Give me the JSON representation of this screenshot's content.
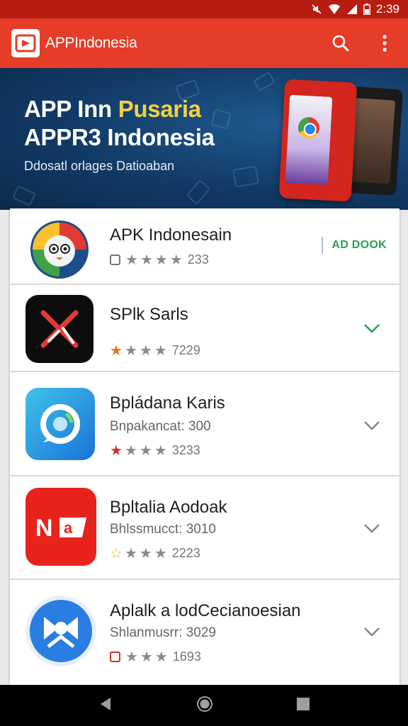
{
  "status_bar": {
    "time": "2:39"
  },
  "app_bar": {
    "title": "APPIndonesia"
  },
  "hero": {
    "title_line1_white": "APP Inn ",
    "title_line1_accent": "Pusaria",
    "title_line2": "APPR3 Indonesia",
    "subtitle": "Ddosatl orlages Datioaban"
  },
  "apps": [
    {
      "name": "APK Indonesain",
      "sub": "",
      "rating": "233",
      "action_label": "AD DOOK",
      "lead": "box-gray"
    },
    {
      "name": "SPlk Sarls",
      "sub": "",
      "rating": "7229",
      "lead": "star-orange"
    },
    {
      "name": "Bpládana Karis",
      "sub": "Bnpakancat: 300",
      "rating": "3233",
      "lead": "star-red"
    },
    {
      "name": "Bpltalia Aodoak",
      "sub": "Bhlssmucct: 3010",
      "rating": "2223",
      "lead": "star-yellow"
    },
    {
      "name": "Aplalk a lodCecianoesian",
      "sub": "Shlanmusrr: 3029",
      "rating": "1693",
      "lead": "box-red"
    }
  ],
  "colors": {
    "app_bar": "#e53d27",
    "status_bar": "#b71c10",
    "hero_bg": "#123a66",
    "accent_yellow": "#f4d03f",
    "add_green": "#2e9e4f",
    "chevron_gray": "#8a8a8a",
    "chevron_green": "#2e9e4f"
  },
  "icons": {
    "status": [
      "mute-icon",
      "wifi-icon",
      "signal-icon",
      "battery-icon"
    ],
    "app_bar": [
      "app-logo-icon",
      "search-icon",
      "more-vert-icon"
    ],
    "nav": [
      "back-icon",
      "home-icon",
      "recents-icon"
    ]
  }
}
